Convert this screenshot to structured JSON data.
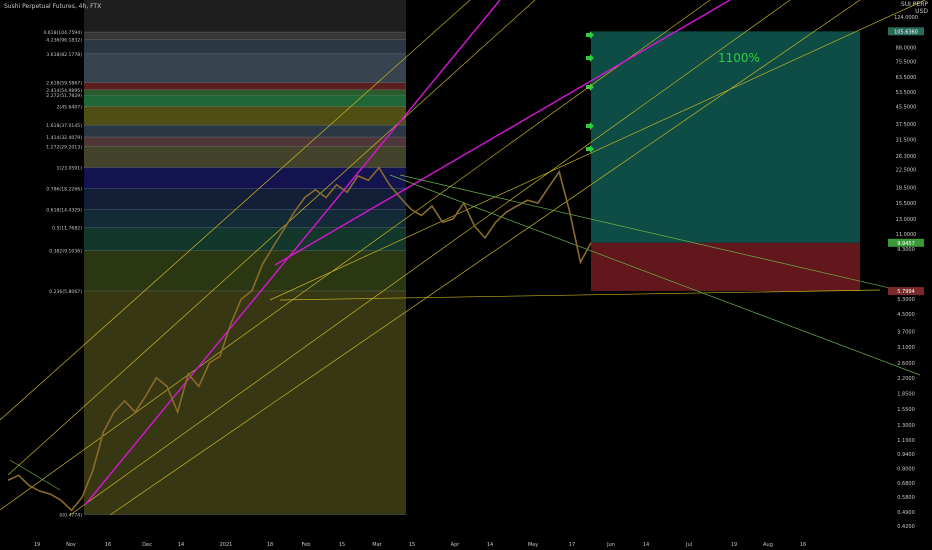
{
  "header": {
    "title": "Sushi Perpetual Futures, 4h, FTX",
    "axis_unit_top": "SUI PERP",
    "axis_currency": "USD"
  },
  "annotation": {
    "target_label": "1100%",
    "color": "#2ecc40"
  },
  "price_badges": {
    "current": "9.9457",
    "stop": "5.7994",
    "target": "105.6360"
  },
  "colors": {
    "background": "#000000",
    "candle": "#8a6b2a",
    "channel_primary": "#d914d6",
    "channel_secondary": "#c7b422",
    "trendline": "#6fb24a",
    "long_profit_zone": "#0f5a52",
    "long_loss_zone": "#6b1a1e"
  },
  "chart_data": {
    "type": "line",
    "title": "Sushi Perpetual Futures, 4h, FTX",
    "scale": "log",
    "ylim": [
      0.42,
      124.0
    ],
    "y_ticks": [
      "124.0000",
      "88.0000",
      "75.5000",
      "63.5000",
      "53.5000",
      "45.5000",
      "37.5000",
      "31.5000",
      "26.3000",
      "22.5000",
      "18.5000",
      "15.5000",
      "13.0000",
      "11.0000",
      "9.3000",
      "5.3000",
      "4.5000",
      "3.7000",
      "3.1000",
      "2.6000",
      "2.2000",
      "1.8500",
      "1.5500",
      "1.3000",
      "1.1000",
      "0.9400",
      "0.8000",
      "0.6800",
      "0.5800",
      "0.4900",
      "0.4200"
    ],
    "x_ticks": [
      "19",
      "Nov",
      "16",
      "Dec",
      "14",
      "2021",
      "18",
      "Feb",
      "15",
      "Mar",
      "15",
      "Apr",
      "14",
      "May",
      "17",
      "Jun",
      "14",
      "Jul",
      "19",
      "Aug",
      "16"
    ],
    "series": [
      {
        "values": [
          0.7,
          0.74,
          0.66,
          0.62,
          0.6,
          0.56,
          0.5,
          0.58,
          0.78,
          1.2,
          1.5,
          1.7,
          1.5,
          1.8,
          2.2,
          2.0,
          1.5,
          2.3,
          2.0,
          2.6,
          2.8,
          4.0,
          5.3,
          5.8,
          7.8,
          9.5,
          11.5,
          14.0,
          16.5,
          18.0,
          16.5,
          19.0,
          17.5,
          21.0,
          20.0,
          23.0,
          19.0,
          16.5,
          14.5,
          13.5,
          15.0,
          12.5,
          13.0,
          15.5,
          12.0,
          10.5,
          12.5,
          14.0,
          15.0,
          16.0,
          15.5,
          18.5,
          22.0,
          14.0,
          8.0,
          9.9457
        ]
      }
    ],
    "fib_levels": [
      {
        "label": "4.618(104.7594)",
        "value": 104.7594
      },
      {
        "label": "4.236(96.1832)",
        "value": 96.1832
      },
      {
        "label": "3.618(82.1778)",
        "value": 82.1778
      },
      {
        "label": "2.618(59.5867)",
        "value": 59.5867
      },
      {
        "label": "2.414(54.9895)",
        "value": 54.9895
      },
      {
        "label": "2.272(51.7829)",
        "value": 51.7829
      },
      {
        "label": "2(45.6407)",
        "value": 45.6407
      },
      {
        "label": "1.618(37.0145)",
        "value": 37.0145
      },
      {
        "label": "1.414(32.4079)",
        "value": 32.4079
      },
      {
        "label": "1.272(29.2013)",
        "value": 29.2013
      },
      {
        "label": "1(23.0591)",
        "value": 23.0591
      },
      {
        "label": "0.786(18.2266)",
        "value": 18.2266
      },
      {
        "label": "0.618(14.4329)",
        "value": 14.4329
      },
      {
        "label": "0.5(11.7682)",
        "value": 11.7682
      },
      {
        "label": "0.382(9.1036)",
        "value": 9.1036
      },
      {
        "label": "0.236(5.8067)",
        "value": 5.8067
      },
      {
        "label": "0(0.4774)",
        "value": 0.4774
      }
    ],
    "grid": false,
    "legend": "none"
  }
}
